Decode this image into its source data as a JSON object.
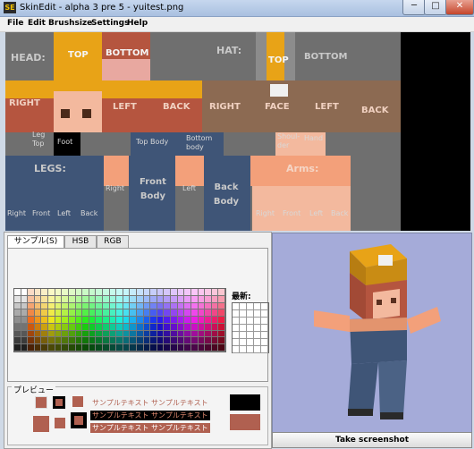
{
  "window": {
    "app_icon_text": "SE",
    "title": "SkinEdit - alpha 3 pre 5 - yuitest.png",
    "minimize": "─",
    "maximize": "□",
    "close": "✕"
  },
  "menu": [
    "File",
    "Edit",
    "Brushsize",
    "Settings",
    "Help"
  ],
  "skin_labels": {
    "head": "HEAD:",
    "head_top": "TOP",
    "head_bottom": "BOTTOM",
    "head_right": "RIGHT",
    "head_left": "LEFT",
    "head_back": "BACK",
    "hat": "HAT:",
    "hat_top": "TOP",
    "hat_bottom": "BOTTOM",
    "hat_right": "RIGHT",
    "hat_face": "FACE",
    "hat_left": "LEFT",
    "hat_back": "BACK",
    "leg_top": "Leg Top",
    "foot": "Foot",
    "top_body": "Top Body",
    "bottom_body": "Bottom body",
    "shoulder": "Shoul-der",
    "hand": "Hand",
    "legs": "LEGS:",
    "front_body": "Front Body",
    "back_body": "Back Body",
    "right": "Right",
    "left": "Left",
    "arms": "Arms:",
    "leg_right": "Right",
    "leg_front": "Front",
    "leg_left": "Left",
    "leg_back": "Back",
    "arm_right": "Right",
    "arm_front": "Front",
    "arm_left": "Left",
    "arm_back": "Back"
  },
  "tabs": [
    "サンプル(S)",
    "HSB",
    "RGB"
  ],
  "recent_label": "最新:",
  "preview": {
    "label": "プレビュー",
    "sample_text": "サンプルテキスト サンプルテキスト"
  },
  "screenshot_button": "Take screenshot",
  "colors": {
    "skin_bg": "#6f6f6f",
    "hat_yellow": "#e8a317",
    "hair": "#b5553f",
    "skin": "#f3b99e",
    "overalls": "#3f5577",
    "model_bg": "#a5abd9"
  }
}
